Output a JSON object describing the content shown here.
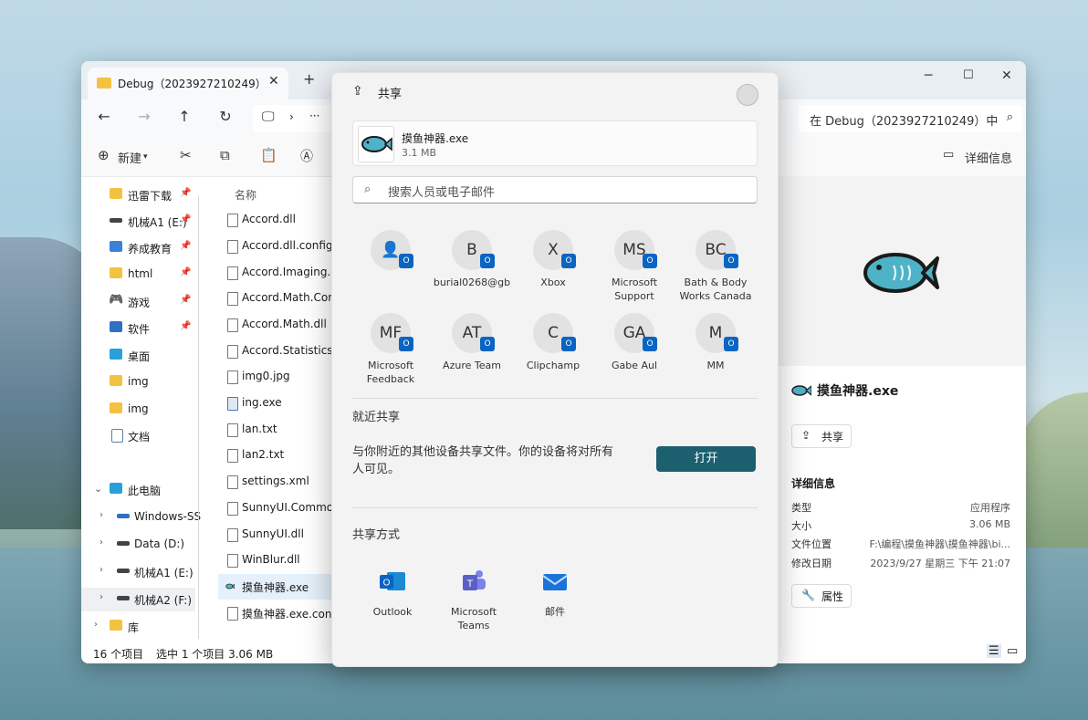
{
  "window": {
    "tab_title": "Debug（2023927210249）",
    "search_text": "在 Debug（2023927210249）中",
    "more_label": "···"
  },
  "toolbar": {
    "new_label": "新建",
    "details_label": "详细信息"
  },
  "sidebar": {
    "items": [
      {
        "label": "迅雷下载",
        "icon": "folder-icon"
      },
      {
        "label": "机械A1 (E:)",
        "icon": "drive-icon"
      },
      {
        "label": "养成教育",
        "icon": "folder-blue-icon"
      },
      {
        "label": "html",
        "icon": "folder-icon"
      },
      {
        "label": "游戏",
        "icon": "gamepad-icon"
      },
      {
        "label": "软件",
        "icon": "code-icon"
      },
      {
        "label": "桌面",
        "icon": "desktop-icon"
      },
      {
        "label": "img",
        "icon": "folder-icon"
      },
      {
        "label": "img",
        "icon": "folder-icon"
      },
      {
        "label": "文档",
        "icon": "document-icon"
      },
      {
        "label": "此电脑",
        "icon": "computer-icon"
      },
      {
        "label": "Windows-SS",
        "icon": "windows-drive-icon"
      },
      {
        "label": "Data (D:)",
        "icon": "drive-icon"
      },
      {
        "label": "机械A1 (E:)",
        "icon": "drive-icon"
      },
      {
        "label": "机械A2 (F:)",
        "icon": "drive-icon"
      },
      {
        "label": "库",
        "icon": "library-icon"
      }
    ]
  },
  "files": {
    "column_header": "名称",
    "rows": [
      "Accord.dll",
      "Accord.dll.config",
      "Accord.Imaging.dll",
      "Accord.Math.Core.dll",
      "Accord.Math.dll",
      "Accord.Statistics.dll",
      "img0.jpg",
      "ing.exe",
      "lan.txt",
      "lan2.txt",
      "settings.xml",
      "SunnyUI.Common.dll",
      "SunnyUI.dll",
      "WinBlur.dll",
      "摸鱼神器.exe",
      "摸鱼神器.exe.config"
    ]
  },
  "status": {
    "count": "16 个项目",
    "selected": "选中 1 个项目  3.06 MB"
  },
  "details": {
    "file_name": "摸鱼神器.exe",
    "share_label": "共享",
    "section_title": "详细信息",
    "props": [
      {
        "k": "类型",
        "v": "应用程序"
      },
      {
        "k": "大小",
        "v": "3.06 MB"
      },
      {
        "k": "文件位置",
        "v": "F:\\编程\\摸鱼神器\\摸鱼神器\\bi..."
      },
      {
        "k": "修改日期",
        "v": "2023/9/27 星期三 下午 21:07"
      }
    ],
    "properties_label": "属性"
  },
  "share": {
    "title": "共享",
    "file_name": "摸鱼神器.exe",
    "file_size": "3.1 MB",
    "search_placeholder": "搜索人员或电子邮件",
    "contacts": [
      {
        "initials": "",
        "name": ""
      },
      {
        "initials": "B",
        "name": "burial0268@gb"
      },
      {
        "initials": "X",
        "name": "Xbox"
      },
      {
        "initials": "MS",
        "name": "Microsoft Support"
      },
      {
        "initials": "BC",
        "name": "Bath & Body Works Canada"
      },
      {
        "initials": "MF",
        "name": "Microsoft Feedback"
      },
      {
        "initials": "AT",
        "name": "Azure Team"
      },
      {
        "initials": "C",
        "name": "Clipchamp"
      },
      {
        "initials": "GA",
        "name": "Gabe Aul"
      },
      {
        "initials": "M",
        "name": "MM"
      }
    ],
    "nearby_title": "就近共享",
    "nearby_text": "与你附近的其他设备共享文件。你的设备将对所有人可见。",
    "open_label": "打开",
    "methods_title": "共享方式",
    "apps": [
      {
        "name": "Outlook",
        "color": "#0a64c2"
      },
      {
        "name": "Microsoft Teams",
        "color": "#5b5fc7"
      },
      {
        "name": "邮件",
        "color": "#1a73d9"
      }
    ]
  }
}
